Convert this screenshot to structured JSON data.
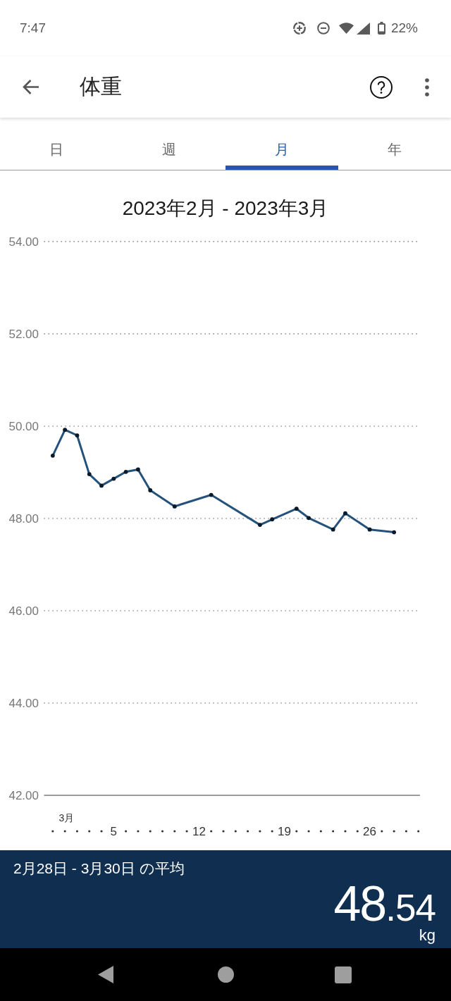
{
  "status_bar": {
    "time": "7:47",
    "battery": "22%"
  },
  "app_bar": {
    "title": "体重"
  },
  "tabs": [
    {
      "label": "日",
      "selected": false
    },
    {
      "label": "週",
      "selected": false
    },
    {
      "label": "月",
      "selected": true
    },
    {
      "label": "年",
      "selected": false
    }
  ],
  "chart": {
    "chart_data": {
      "type": "line",
      "title": "2023年2月 - 2023年3月",
      "x": [
        0,
        1,
        2,
        3,
        4,
        5,
        6,
        7,
        8,
        10,
        13,
        17,
        18,
        20,
        21,
        23,
        24,
        26,
        28
      ],
      "series": [
        {
          "color": "#24527a",
          "marker": true,
          "values": [
            49.36,
            49.92,
            49.8,
            48.96,
            48.71,
            48.86,
            49.01,
            49.06,
            48.61,
            48.26,
            48.51,
            47.86,
            47.98,
            48.21,
            48.01,
            47.76,
            48.11,
            47.76,
            47.7
          ]
        }
      ],
      "xlim": [
        -0.72,
        30.13
      ],
      "ylim": [
        42,
        54
      ],
      "grid": true,
      "xticks": [
        {
          "value": 5,
          "label": "5"
        },
        {
          "value": 12,
          "label": "12"
        },
        {
          "value": 19,
          "label": "19"
        },
        {
          "value": 26,
          "label": "26"
        }
      ],
      "yticks": [
        {
          "value": 42,
          "label": "42.00"
        },
        {
          "value": 44,
          "label": "44.00"
        },
        {
          "value": 46,
          "label": "46.00"
        },
        {
          "value": 48,
          "label": "48.00"
        },
        {
          "value": 50,
          "label": "50.00"
        },
        {
          "value": 52,
          "label": "52.00"
        },
        {
          "value": 54,
          "label": "54.00"
        }
      ],
      "annotations": [
        "3月"
      ]
    }
  },
  "summary": {
    "label": "2月28日 - 3月30日 の平均",
    "value": "48.54",
    "unit": "kg"
  }
}
